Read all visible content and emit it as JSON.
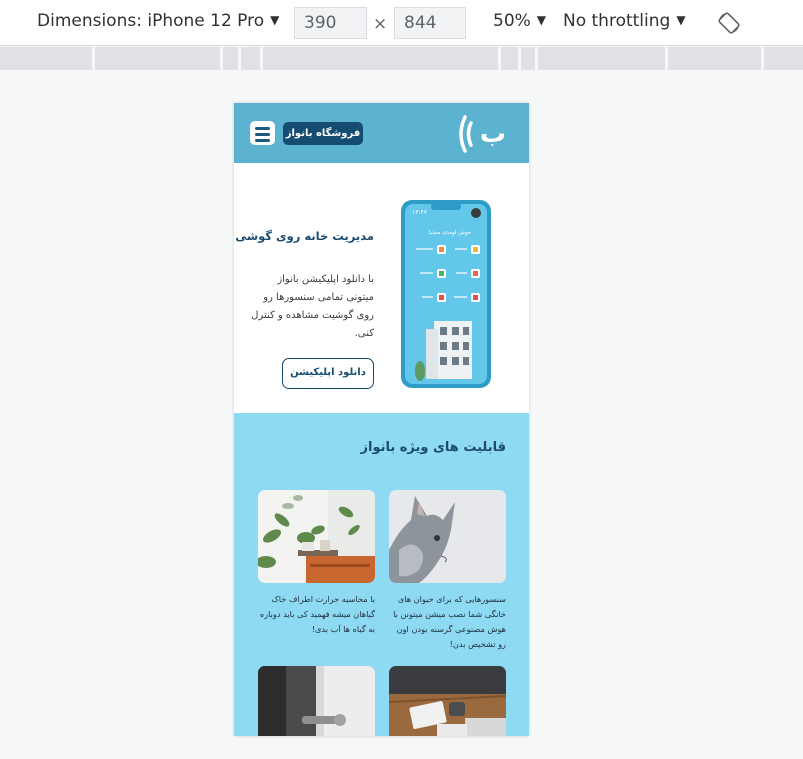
{
  "devtools": {
    "dimensions_label": "Dimensions: iPhone 12 Pro",
    "width_value": "390",
    "times": "×",
    "height_value": "844",
    "zoom": "50%",
    "throttling": "No throttling",
    "caret": "▼"
  },
  "header": {
    "shop_button": "فروشگاه بانواز",
    "logo_letter": "ب"
  },
  "hero": {
    "title": "مدیریت خانه روی گوشی",
    "description": "با دانلود اپلیکیشن بانواز میتونی تمامی سنسورها رو روی گوشیت مشاهده و کنترل کنی.",
    "download_button": "دانلود اپلیکیشن",
    "phone_mock": {
      "time": "۱۳:۴۷",
      "greeting": "خوش اومدی مجتبا"
    }
  },
  "features": {
    "title": "قابلیت های ویژه بانواز",
    "cards": [
      {
        "image": "cat-photo",
        "text": "سنسورهایی که برای حیوان های خانگی شما نصب میشن میتونن با هوش مصنوعی گرسنه بودن اون رو تشخیص بدن!"
      },
      {
        "image": "plants-photo",
        "text": "با محاسبه حرارت اطراف خاک گیاهان میشه فهمید کی باید دوباره به گیاه ها آب بدی!"
      },
      {
        "image": "desk-photo",
        "text": ""
      },
      {
        "image": "door-handle-photo",
        "text": ""
      }
    ]
  },
  "colors": {
    "header_bg": "#5bb3d0",
    "brand_dark": "#154d72",
    "features_bg": "#8fdaf3"
  }
}
